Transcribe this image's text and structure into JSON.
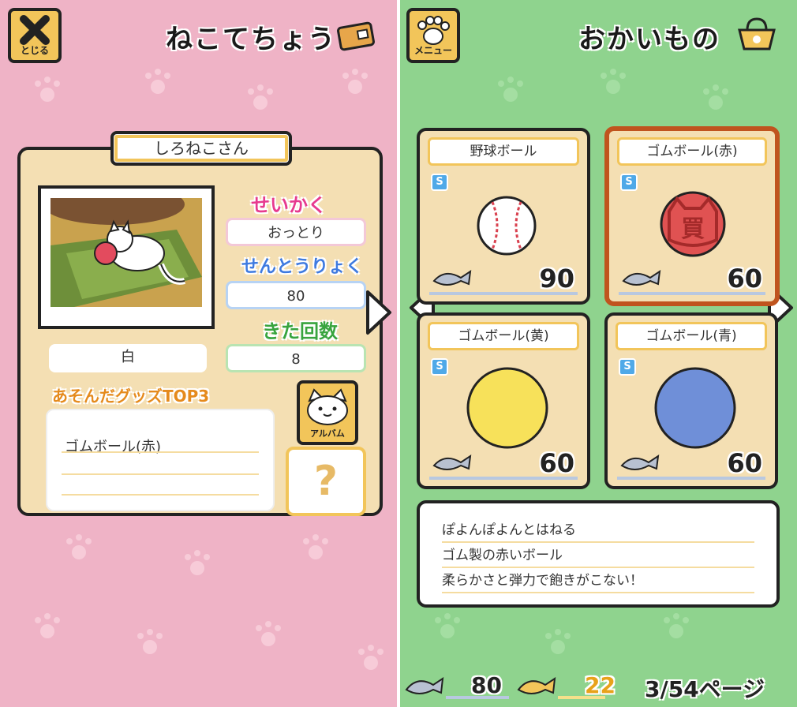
{
  "left": {
    "close_label": "とじる",
    "title": "ねこてちょう",
    "cat_name": "しろねこさん",
    "personality_heading": "せいかく",
    "personality": "おっとり",
    "power_heading": "せんとうりょく",
    "power": "80",
    "visits_heading": "きた回数",
    "visits": "8",
    "color": "白",
    "top3_heading": "あそんだグッズTOP3",
    "top3_items": [
      "ゴムボール(赤)",
      "",
      ""
    ],
    "album_label": "アルバム",
    "mystery": "?"
  },
  "right": {
    "menu_label": "メニュー",
    "title": "おかいもの",
    "items": [
      {
        "name": "野球ボール",
        "rank": "S",
        "price": "90",
        "color": "#ffffff",
        "selected": false
      },
      {
        "name": "ゴムボール(赤)",
        "rank": "S",
        "price": "60",
        "color": "#e05252",
        "selected": true,
        "stamp": "買"
      },
      {
        "name": "ゴムボール(黄)",
        "rank": "S",
        "price": "60",
        "color": "#f7e15a",
        "selected": false
      },
      {
        "name": "ゴムボール(青)",
        "rank": "S",
        "price": "60",
        "color": "#6f8fd8",
        "selected": false
      }
    ],
    "description": [
      "ぽよんぽよんとはねる",
      "ゴム製の赤いボール",
      "柔らかさと弾力で飽きがこない！"
    ],
    "fish_count": "80",
    "gold_fish_count": "22",
    "page": "3/54ページ"
  },
  "colors": {
    "pink_bg": "#efb3c6",
    "green_bg": "#8fd38e",
    "card": "#f4dfb3",
    "accent": "#f2c55a",
    "selected_border": "#c0541e"
  }
}
